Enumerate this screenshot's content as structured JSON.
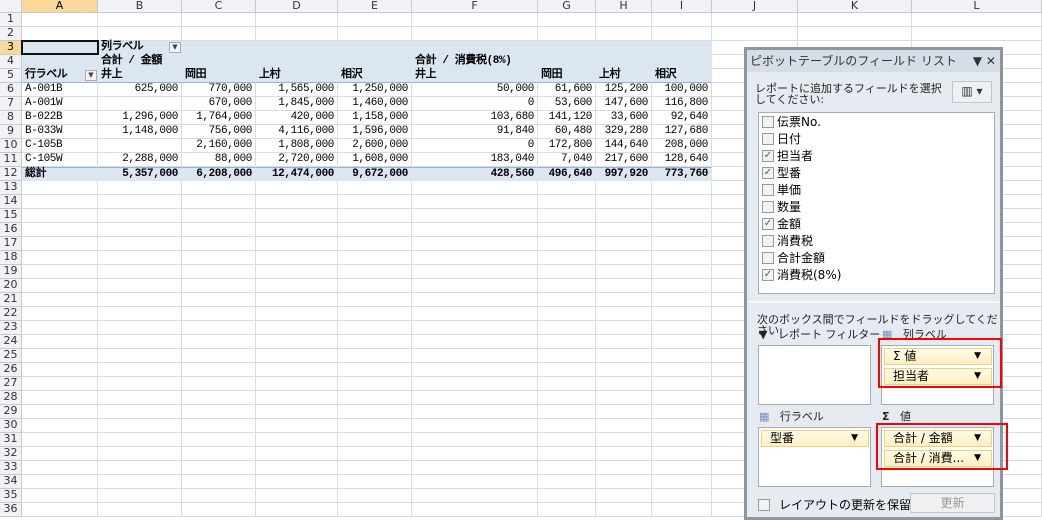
{
  "columns": [
    "A",
    "B",
    "C",
    "D",
    "E",
    "F",
    "G",
    "H",
    "I",
    "J",
    "K",
    "L"
  ],
  "row_count": 36,
  "pivot": {
    "col_label": "列ラベル",
    "measure1": "合計 / 金額",
    "measure2": "合計 / 消費税(8%)",
    "row_label": "行ラベル",
    "headers": [
      "井上",
      "岡田",
      "上村",
      "相沢",
      "井上",
      "岡田",
      "上村",
      "相沢"
    ],
    "rows": [
      {
        "label": "A-001B",
        "values": [
          "625,000",
          "770,000",
          "1,565,000",
          "1,250,000",
          "50,000",
          "61,600",
          "125,200",
          "100,000"
        ]
      },
      {
        "label": "A-001W",
        "values": [
          "",
          "670,000",
          "1,845,000",
          "1,460,000",
          "0",
          "53,600",
          "147,600",
          "116,800"
        ]
      },
      {
        "label": "B-022B",
        "values": [
          "1,296,000",
          "1,764,000",
          "420,000",
          "1,158,000",
          "103,680",
          "141,120",
          "33,600",
          "92,640"
        ]
      },
      {
        "label": "B-033W",
        "values": [
          "1,148,000",
          "756,000",
          "4,116,000",
          "1,596,000",
          "91,840",
          "60,480",
          "329,280",
          "127,680"
        ]
      },
      {
        "label": "C-105B",
        "values": [
          "",
          "2,160,000",
          "1,808,000",
          "2,600,000",
          "0",
          "172,800",
          "144,640",
          "208,000"
        ]
      },
      {
        "label": "C-105W",
        "values": [
          "2,288,000",
          "88,000",
          "2,720,000",
          "1,608,000",
          "183,040",
          "7,040",
          "217,600",
          "128,640"
        ]
      }
    ],
    "total": {
      "label": "総計",
      "values": [
        "5,357,000",
        "6,208,000",
        "12,474,000",
        "9,672,000",
        "428,560",
        "496,640",
        "997,920",
        "773,760"
      ]
    }
  },
  "panel": {
    "title": "ピボットテーブルのフィールド リスト",
    "title_controls": "▼ ✕",
    "prompt": "レポートに追加するフィールドを選択してください:",
    "fields": [
      {
        "label": "伝票No.",
        "checked": false
      },
      {
        "label": "日付",
        "checked": false
      },
      {
        "label": "担当者",
        "checked": true
      },
      {
        "label": "型番",
        "checked": true
      },
      {
        "label": "単価",
        "checked": false
      },
      {
        "label": "数量",
        "checked": false
      },
      {
        "label": "金額",
        "checked": true
      },
      {
        "label": "消費税",
        "checked": false
      },
      {
        "label": "合計金額",
        "checked": false
      },
      {
        "label": "消費税(8%)",
        "checked": true
      }
    ],
    "drag_prompt": "次のボックス間でフィールドをドラッグしてください:",
    "report_filter": "レポート フィルター",
    "column_labels": "列ラベル",
    "row_labels": "行ラベル",
    "values": "値",
    "col_chips": [
      "Σ 値",
      "担当者"
    ],
    "row_chips": [
      "型番"
    ],
    "value_chips": [
      "合計 / 金額",
      "合計 / 消費..."
    ],
    "defer_label": "レイアウトの更新を保留...",
    "update_label": "更新"
  },
  "colors": {
    "pivot_bg": "#dce6f1",
    "highlight": "#ff0000"
  }
}
